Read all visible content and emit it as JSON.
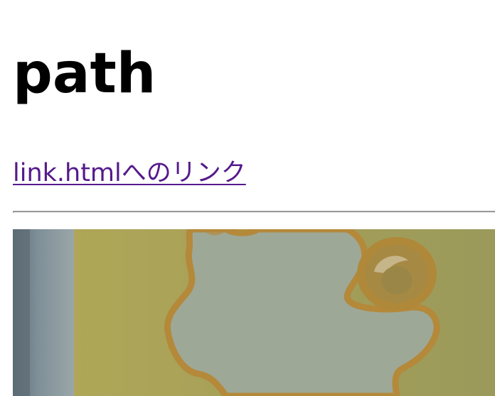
{
  "page": {
    "title": "path",
    "link_text": "link.htmlへのリンク",
    "link_href": "link.html"
  },
  "colors": {
    "visited_link": "#551a8b",
    "rule": "#9a9a9a",
    "photo_background": "#a9a45a",
    "photo_shape_fill": "#9aa694",
    "photo_outline": "#b0863a",
    "photo_left_strip": "#6f7f86"
  },
  "image": {
    "description_icon": "photo-image"
  }
}
